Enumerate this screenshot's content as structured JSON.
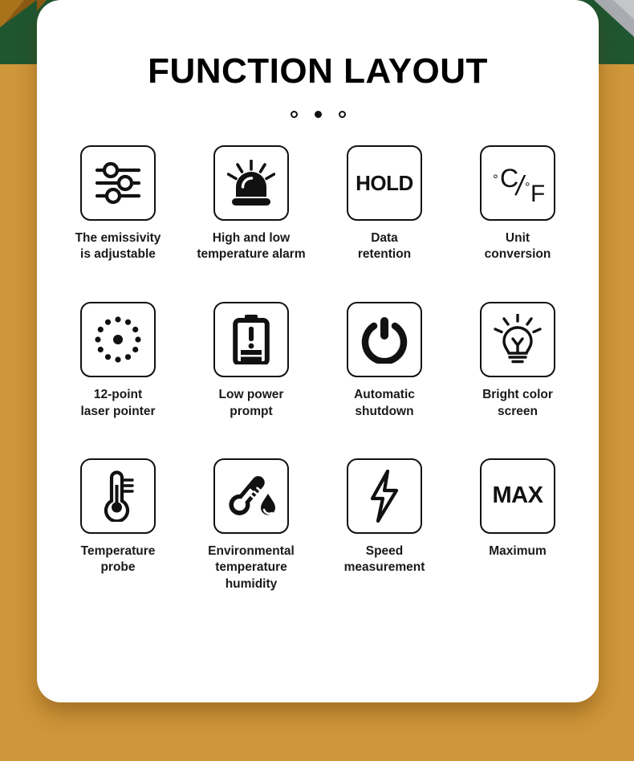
{
  "page": {
    "title": "FUNCTION LAYOUT",
    "background_color": "#D0963A",
    "card_color": "#FFFFFF",
    "accent_green": "#1F5630",
    "accent_gray": "#A8ACB0",
    "accent_brown": "#A86A17"
  },
  "carousel": {
    "dots": [
      {
        "state": "inactive"
      },
      {
        "state": "active"
      },
      {
        "state": "inactive"
      }
    ]
  },
  "features": [
    {
      "icon": "sliders-icon",
      "icon_kind": "glyph",
      "label": "The emissivity\nis adjustable"
    },
    {
      "icon": "alarm-siren-icon",
      "icon_kind": "glyph",
      "label": "High and low\ntemperature alarm"
    },
    {
      "icon": "hold-text-icon",
      "icon_kind": "text",
      "icon_text": "HOLD",
      "label": "Data\nretention"
    },
    {
      "icon": "celsius-fahrenheit-icon",
      "icon_kind": "text",
      "icon_text": "°C/°F",
      "label": "Unit\nconversion"
    },
    {
      "icon": "laser-dots-icon",
      "icon_kind": "glyph",
      "label": "12-point\nlaser pointer"
    },
    {
      "icon": "low-battery-icon",
      "icon_kind": "glyph",
      "label": "Low power\nprompt"
    },
    {
      "icon": "power-button-icon",
      "icon_kind": "glyph",
      "label": "Automatic\nshutdown"
    },
    {
      "icon": "light-bulb-icon",
      "icon_kind": "glyph",
      "label": "Bright color\nscreen"
    },
    {
      "icon": "thermometer-probe-icon",
      "icon_kind": "glyph",
      "label": "Temperature\nprobe"
    },
    {
      "icon": "thermometer-humidity-icon",
      "icon_kind": "glyph",
      "label": "Environmental\ntemperature\nhumidity"
    },
    {
      "icon": "lightning-bolt-icon",
      "icon_kind": "glyph",
      "label": "Speed\nmeasurement"
    },
    {
      "icon": "max-text-icon",
      "icon_kind": "text",
      "icon_text": "MAX",
      "label": "Maximum"
    }
  ]
}
